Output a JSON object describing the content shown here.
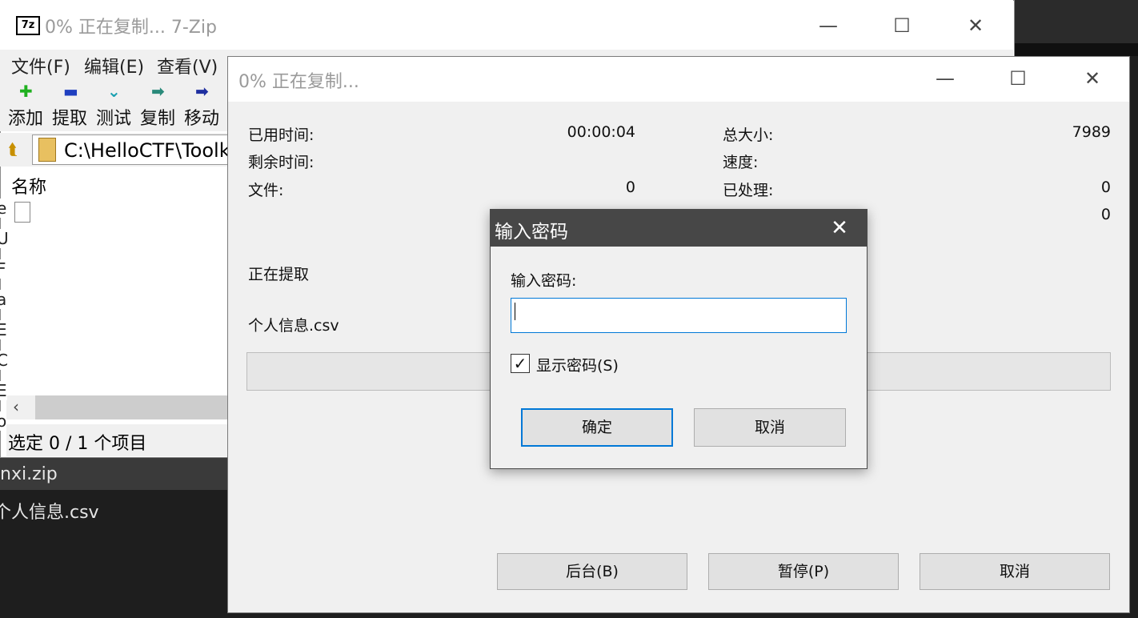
{
  "background": {
    "list_items": [
      "e",
      "U",
      "F",
      "a",
      "E",
      "C",
      "E",
      "o"
    ],
    "selected_file": "nxi.zip",
    "second_file": "个人信息.csv"
  },
  "main_window": {
    "title": "0% 正在复制... 7-Zip",
    "logo_text": "7z",
    "menu": [
      "文件(F)",
      "编辑(E)",
      "查看(V)"
    ],
    "toolbar": [
      {
        "label": "添加",
        "icon": "plus-icon",
        "glyph": "✚",
        "color": "#1fb01f"
      },
      {
        "label": "提取",
        "icon": "minus-icon",
        "glyph": "▬",
        "color": "#1f3fc0"
      },
      {
        "label": "测试",
        "icon": "check-chevron-icon",
        "glyph": "⌄",
        "color": "#1aa0b0"
      },
      {
        "label": "复制",
        "icon": "copy-arrow-icon",
        "glyph": "➡",
        "color": "#2a8a7a"
      },
      {
        "label": "移动",
        "icon": "move-arrow-icon",
        "glyph": "➡",
        "color": "#1f2fa0"
      }
    ],
    "path": "C:\\HelloCTF\\Toolk",
    "column_name": "名称",
    "status": "选定 0 / 1 个项目"
  },
  "progress_dialog": {
    "title": "0% 正在复制...",
    "elapsed_label": "已用时间:",
    "elapsed_value": "00:00:04",
    "remaining_label": "剩余时间:",
    "files_label": "文件:",
    "files_value": "0",
    "total_size_label": "总大小:",
    "total_size_value": "7989",
    "speed_label": "速度:",
    "processed_label": "已处理:",
    "processed_value": "0",
    "compressed_value": "0",
    "action": "正在提取",
    "current_file": "个人信息.csv",
    "progress_fraction": 0,
    "buttons": {
      "background": "后台(B)",
      "pause": "暂停(P)",
      "cancel": "取消"
    }
  },
  "password_dialog": {
    "title": "输入密码",
    "label": "输入密码:",
    "value": "",
    "show_password_label": "显示密码(S)",
    "show_password_checked": true,
    "ok": "确定",
    "cancel": "取消"
  }
}
